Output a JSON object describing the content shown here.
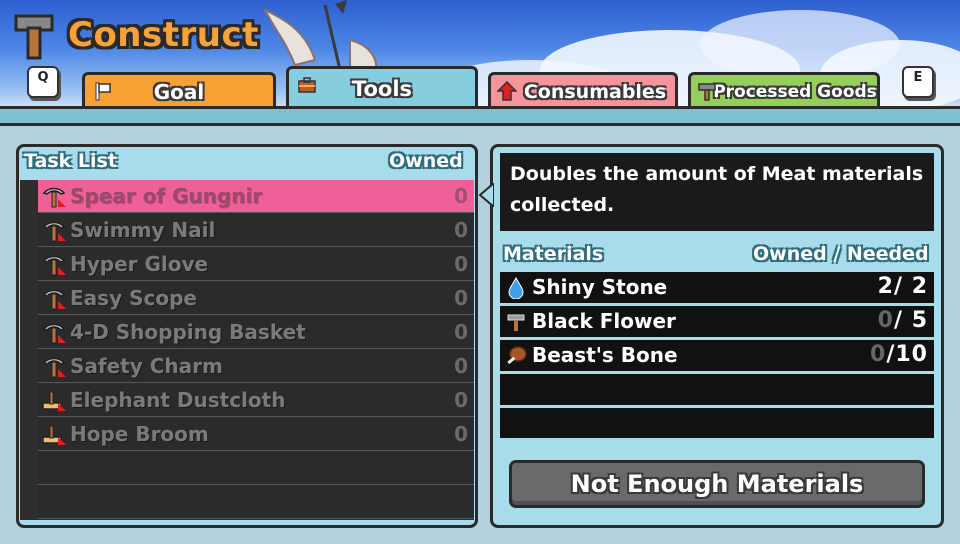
{
  "header": {
    "title": "Construct",
    "title_icon": "hammer-icon",
    "key_left": "Q",
    "key_right": "E"
  },
  "tabs": [
    {
      "label": "Goal",
      "icon": "flag-icon",
      "color": "#f7a033",
      "active": false
    },
    {
      "label": "Tools",
      "icon": "toolbox-icon",
      "color": "#86cde0",
      "active": true
    },
    {
      "label": "Consumables",
      "icon": "up-arrow-icon",
      "color": "#f5949a",
      "active": false
    },
    {
      "label": "Processed Goods",
      "icon": "hammer-icon",
      "color": "#93cf5a",
      "active": false
    }
  ],
  "task_list": {
    "header_label": "Task List",
    "owned_label": "Owned",
    "items": [
      {
        "name": "Spear of Gungnir",
        "owned": "0",
        "icon": "pickaxe-icon",
        "selected": true
      },
      {
        "name": "Swimmy Nail",
        "owned": "0",
        "icon": "pickaxe-icon"
      },
      {
        "name": "Hyper Glove",
        "owned": "0",
        "icon": "pickaxe-icon"
      },
      {
        "name": "Easy Scope",
        "owned": "0",
        "icon": "pickaxe-icon"
      },
      {
        "name": "4-D Shopping Basket",
        "owned": "0",
        "icon": "pickaxe-icon"
      },
      {
        "name": "Safety Charm",
        "owned": "0",
        "icon": "pickaxe-icon"
      },
      {
        "name": "Elephant Dustcloth",
        "owned": "0",
        "icon": "broom-icon"
      },
      {
        "name": "Hope Broom",
        "owned": "0",
        "icon": "broom-icon"
      }
    ]
  },
  "detail": {
    "description": "Doubles the amount of Meat materials collected.",
    "materials_label": "Materials",
    "owned_needed_label": "Owned / Needed",
    "materials": [
      {
        "name": "Shiny Stone",
        "owned": "2",
        "needed": "2",
        "icon": "water-drop-icon"
      },
      {
        "name": "Black Flower",
        "owned": "0",
        "needed": "5",
        "icon": "hammer-icon"
      },
      {
        "name": "Beast's Bone",
        "owned": "0",
        "needed": "10",
        "icon": "meat-icon"
      }
    ],
    "action_button": "Not Enough Materials"
  }
}
